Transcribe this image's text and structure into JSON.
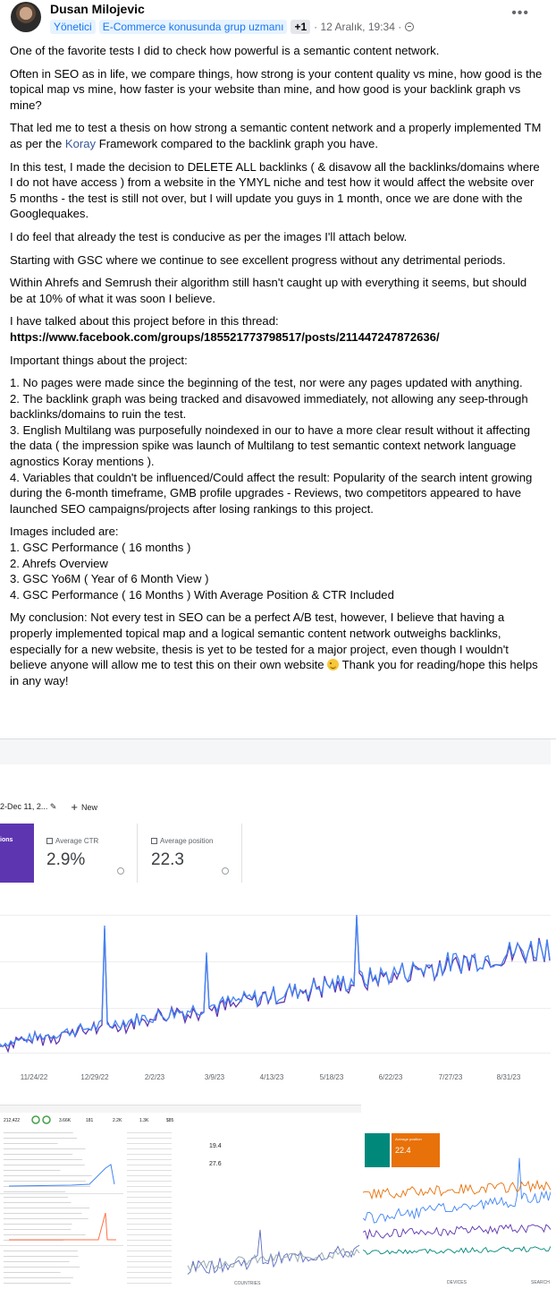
{
  "post": {
    "author": "Dusan Milojevic",
    "role_badge": "Yönetici",
    "group_badge": "E-Commerce konusunda grup uzmanı",
    "extra_badges": "+1",
    "timestamp": "· 12 Aralık, 19:34 ·",
    "more": "•••",
    "paragraphs": {
      "p1": "One of the favorite tests I did to check how powerful is a semantic content network.",
      "p2": "Often in SEO as in life, we compare things, how strong is your content quality vs mine, how good is the topical map vs mine, how faster is your website than mine, and how good is your backlink graph vs mine?",
      "p3a": "That led me to test a thesis on how strong a semantic content network and a properly implemented TM as per the ",
      "p3link": "Koray",
      "p3b": " Framework compared to the backlink graph you have.",
      "p4": "In this test, I made the decision to DELETE ALL backlinks ( & disavow all the backlinks/domains where I do not have access ) from a website in the YMYL niche and test how it would affect the website over 5 months - the test is still not over, but I will update you guys in 1 month, once we are done with the Googlequakes.",
      "p5": " I do feel that already the test is conducive as per the images I'll attach below.",
      "p6": "Starting with GSC where we continue to see excellent progress without any detrimental periods.",
      "p7": "Within Ahrefs and Semrush their algorithm still hasn't caught up with everything it seems, but should be at 10% of what it was soon I believe.",
      "p8": "I have talked about this project before in this thread:",
      "p8link": "https://www.facebook.com/groups/185521773798517/posts/211447247872636/",
      "p9": "Important things about the project:",
      "l1": "1. No pages were made since the beginning of the test, nor were any pages updated with anything.",
      "l2": "2. The backlink graph was being tracked and disavowed immediately, not allowing any seep-through backlinks/domains to ruin the test.",
      "l3": "3. English Multilang was purposefully noindexed in our to have a more clear result without it affecting the data ( the impression spike was launch of Multilang to test semantic context network language agnostics Koray mentions ).",
      "l4": "4. Variables that couldn't be influenced/Could affect the result: Popularity of the search intent growing during the 6-month timeframe, GMB profile upgrades - Reviews, two competitors appeared to have launched SEO campaigns/projects after losing rankings to this project.",
      "p10": "Images included are:",
      "i1": "1. GSC Performance ( 16 months )",
      "i2": "2. Ahrefs Overview",
      "i3": "3. GSC Yo6M ( Year of 6 Month View )",
      "i4": "4. GSC Performance ( 16 Months ) With Average Position & CTR Included",
      "p11a": "My conclusion: Not every test in SEO can be a perfect A/B test, however, I believe that having a properly implemented topical map and a logical semantic content network outweighs backlinks, especially for a new website, thesis is yet to be tested for a major project, even though I wouldn't believe anyone will allow me to test this on their own website ",
      "p11b": " Thank you for reading/hope this helps in any way!"
    }
  },
  "image1": {
    "date_range": "2-Dec 11, 2...",
    "new_label": "New",
    "clicks_label": "ions",
    "ctr_label": "Average CTR",
    "ctr_value": "2.9%",
    "position_label": "Average position",
    "position_value": "22.3",
    "x_ticks": [
      "11/24/22",
      "12/29/22",
      "2/2/23",
      "3/9/23",
      "4/13/23",
      "5/18/23",
      "6/22/23",
      "7/27/23",
      "8/31/23"
    ],
    "colors": {
      "clicks": "#5e35b1",
      "impressions": "#4285f4"
    }
  },
  "image2": {
    "metrics": [
      "212,422",
      "3.66K",
      "181",
      "2.2K",
      "1.3K",
      "$85"
    ],
    "kw_values": [
      "19.4",
      "27.6"
    ],
    "bottom_labels": [
      "COUNTRIES",
      "DEVICES",
      "SEARCH"
    ]
  },
  "image3": {
    "position_label": "Average position",
    "position_value": "22.4",
    "colors": {
      "teal": "#00897b",
      "orange": "#e8710a"
    }
  }
}
